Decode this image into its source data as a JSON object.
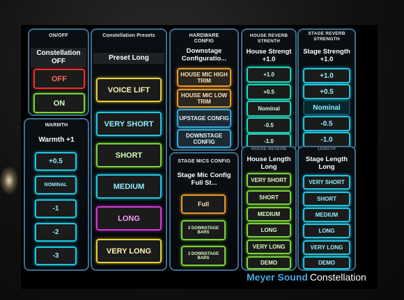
{
  "on_off": {
    "title": "ON/OFF",
    "status": "Constellation OFF",
    "buttons": [
      "OFF",
      "ON"
    ]
  },
  "warmth": {
    "title": "WARMTH",
    "status": "Warmth +1",
    "buttons": [
      "+0.5",
      "NOMINAL",
      "-1",
      "-2",
      "-3"
    ]
  },
  "presets": {
    "title": "Constellation Presets",
    "status": "Preset Long",
    "buttons": [
      "VOICE LIFT",
      "VERY SHORT",
      "SHORT",
      "MEDIUM",
      "LONG",
      "VERY LONG"
    ]
  },
  "hardware": {
    "title": "HARDWARE CONFIG",
    "status": "Downstage Configuratio...",
    "buttons": [
      "HOUSE MIC HIGH TRIM",
      "HOUSE MIC LOW TRIM",
      "UPSTAGE CONFIG",
      "DOWNSTAGE CONFIG"
    ]
  },
  "stage_mics": {
    "title": "STAGE MICS CONFIG",
    "status": "Stage Mic Config Full St...",
    "buttons": [
      "Full",
      "3 DOWNSTAGE BARS",
      "2 DOWNSTAGE BARS"
    ]
  },
  "house_reverb": {
    "title": "HOUSE REVERB STRENTH",
    "status": "House Strengt +1.0",
    "buttons": [
      "+1.0",
      "+0.5",
      "Nominal",
      "-0.5",
      "-1.0"
    ]
  },
  "house_length": {
    "title": "HOUSE REVERB LENGTH",
    "status": "House Length Long",
    "buttons": [
      "VERY SHORT",
      "SHORT",
      "MEDIUM",
      "LONG",
      "VERY LONG",
      "DEMO"
    ]
  },
  "stage_reverb": {
    "title": "STAGE REVERB STRENGTH",
    "status": "Stage Strength +1.0",
    "buttons": [
      "+1.0",
      "+0.5",
      "Nominal",
      "-0.5",
      "-1.0"
    ]
  },
  "stage_length": {
    "title": "LENGTH",
    "status": "Stage Length Long",
    "buttons": [
      "VERY SHORT",
      "SHORT",
      "MEDIUM",
      "LONG",
      "VERY LONG",
      "DEMO"
    ]
  },
  "brand": {
    "company": "Meyer Sound",
    "product": "Constellation"
  }
}
